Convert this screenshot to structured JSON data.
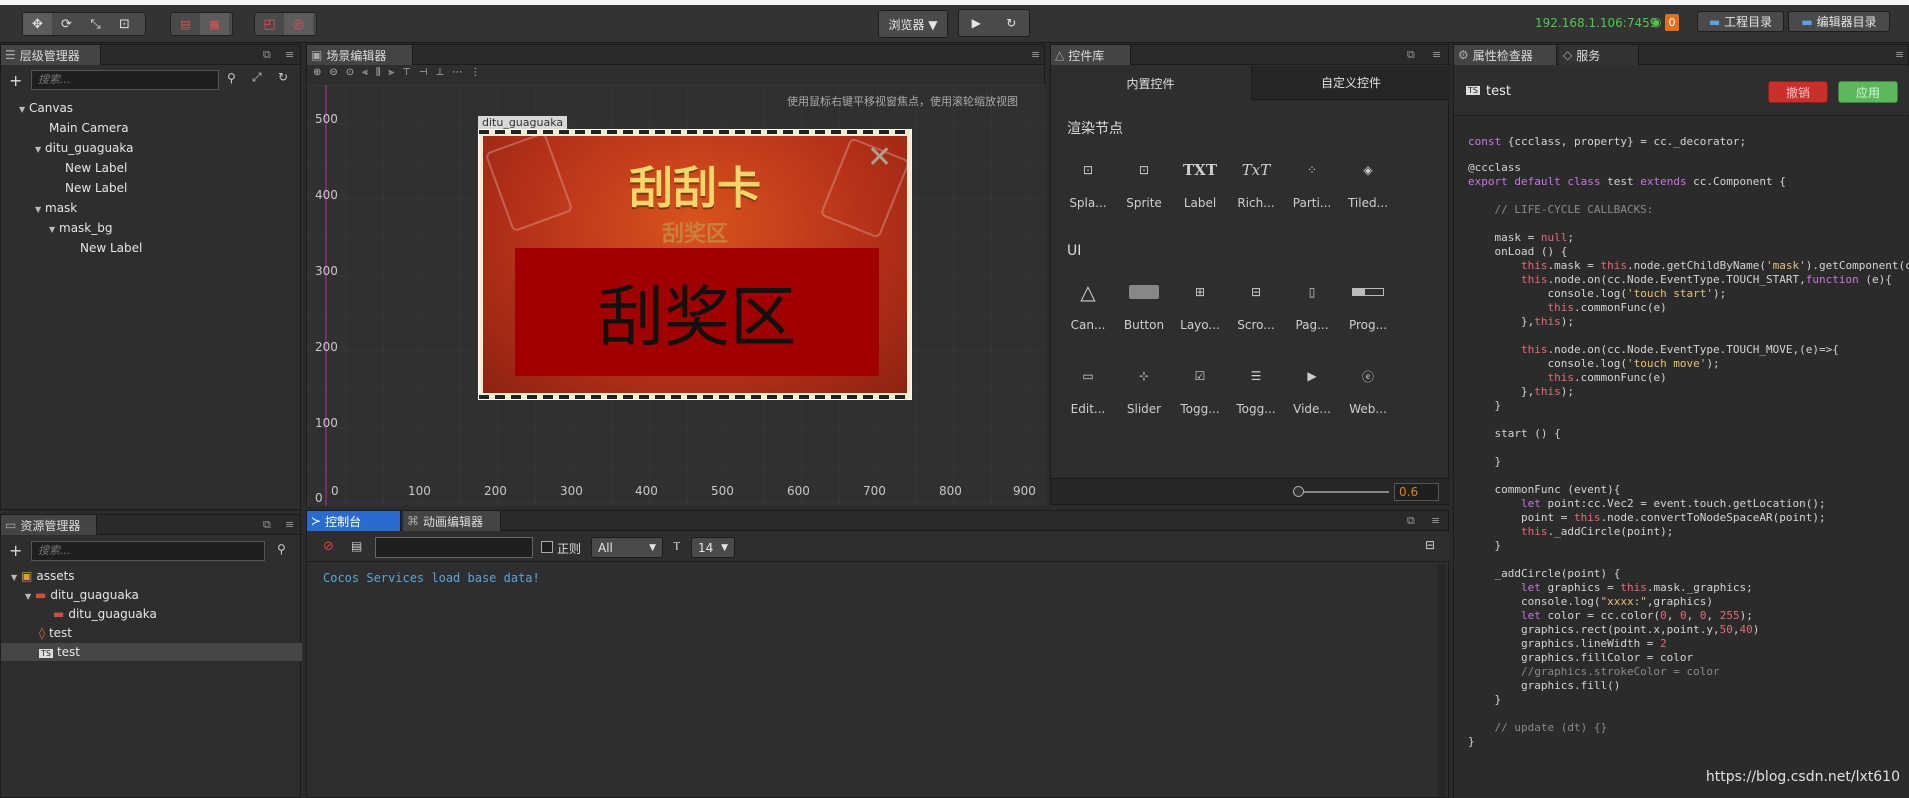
{
  "toolbar": {
    "browser_label": "浏览器 ▼",
    "ip": "192.168.1.106:7459",
    "badge": "0",
    "project_dir": "工程目录",
    "editor_dir": "编辑器目录"
  },
  "hierarchy": {
    "tab": "层级管理器",
    "search_placeholder": "搜索...",
    "items": [
      "Canvas",
      "Main Camera",
      "ditu_guaguaka",
      "New Label",
      "New Label",
      "mask",
      "mask_bg",
      "New Label"
    ]
  },
  "assets": {
    "tab": "资源管理器",
    "search_placeholder": "搜索...",
    "items": [
      "assets",
      "ditu_guaguaka",
      "ditu_guaguaka",
      "test",
      "test"
    ]
  },
  "scene": {
    "tab": "场景编辑器",
    "hint": "使用鼠标右键平移视窗焦点，使用滚轮缩放视图",
    "node_label": "ditu_guaguaka",
    "card_title": "刮刮卡",
    "card_subtitle": "刮奖区",
    "card_area_text": "刮奖区",
    "x_ticks": [
      "0",
      "100",
      "200",
      "300",
      "400",
      "500",
      "600",
      "700",
      "800",
      "900"
    ],
    "y_ticks": [
      "500",
      "400",
      "300",
      "200",
      "100",
      "0"
    ]
  },
  "library": {
    "tab": "控件库",
    "tab_builtin": "内置控件",
    "tab_custom": "自定义控件",
    "section_render": "渲染节点",
    "section_ui": "UI",
    "render_items": [
      "Spla...",
      "Sprite",
      "Label",
      "Rich...",
      "Parti...",
      "Tiled..."
    ],
    "ui_row1": [
      "Can...",
      "Button",
      "Layo...",
      "Scro...",
      "Pag...",
      "Prog..."
    ],
    "ui_row2": [
      "Edit...",
      "Slider",
      "Togg...",
      "Togg...",
      "Vide...",
      "Web..."
    ],
    "zoom_value": "0.6"
  },
  "console": {
    "tab": "控制台",
    "tab2": "动画编辑器",
    "regex_label": "正则",
    "filter_value": "All",
    "font_size": "14",
    "log": "Cocos Services load base data!"
  },
  "inspector": {
    "tab": "属性检查器",
    "tab2": "服务",
    "file": "test",
    "revert": "撤销",
    "apply": "应用",
    "watermark": "https://blog.csdn.net/lxt610"
  },
  "colors": {
    "accent_blue": "#2a6bcf",
    "ip_green": "#4ec94e",
    "revert_red": "#c9302c",
    "apply_green": "#5cb85c"
  }
}
